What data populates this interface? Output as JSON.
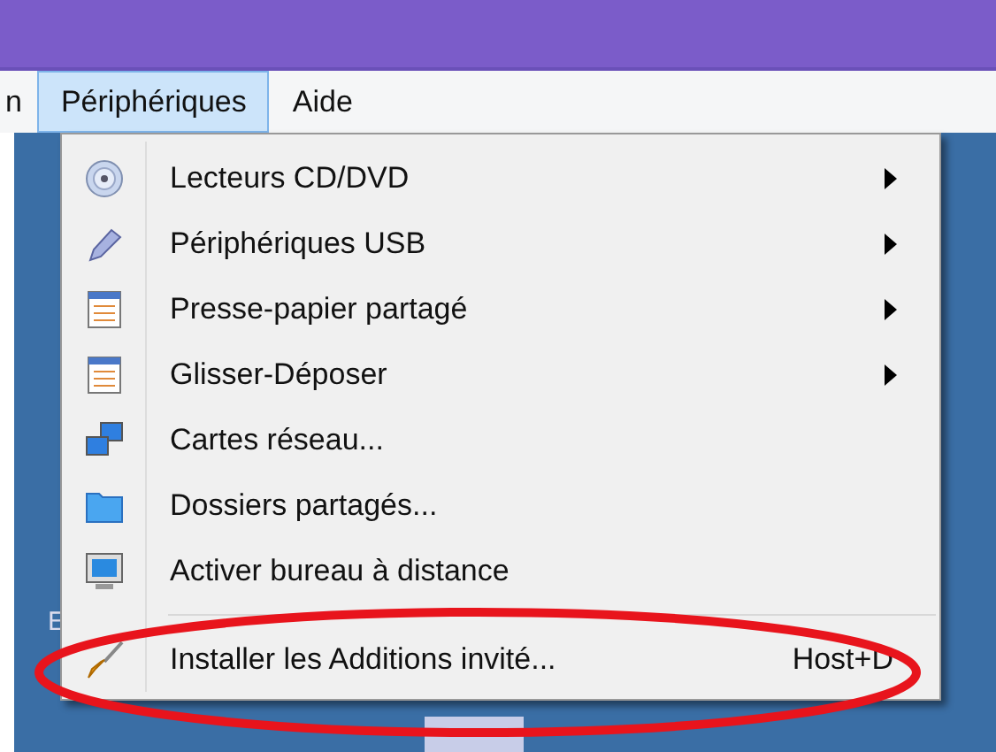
{
  "menubar": {
    "items": [
      {
        "label": "n",
        "selected": false
      },
      {
        "label": "Périphériques",
        "selected": true
      },
      {
        "label": "Aide",
        "selected": false
      }
    ]
  },
  "menu": {
    "items": [
      {
        "kind": "submenu",
        "label": "Lecteurs CD/DVD"
      },
      {
        "kind": "submenu",
        "label": "Périphériques USB"
      },
      {
        "kind": "submenu",
        "label": "Presse-papier partagé"
      },
      {
        "kind": "submenu",
        "label": "Glisser-Déposer"
      },
      {
        "kind": "action",
        "label": "Cartes réseau..."
      },
      {
        "kind": "action",
        "label": "Dossiers partagés..."
      },
      {
        "kind": "action",
        "label": "Activer bureau à distance"
      },
      {
        "kind": "separator"
      },
      {
        "kind": "action",
        "label": "Installer les Additions invité...",
        "shortcut": "Host+D",
        "highlighted": true
      }
    ]
  },
  "desktop": {
    "icon_label": "E"
  }
}
